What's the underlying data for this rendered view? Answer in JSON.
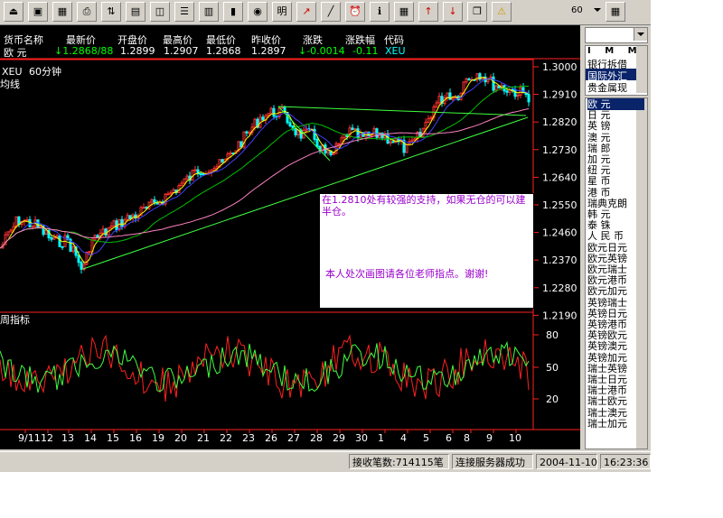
{
  "toolbar": {
    "buttons": [
      "exit-icon",
      "window-icon",
      "grid-icon",
      "print-icon",
      "sort-icon",
      "tile-icon",
      "chart-icon",
      "list-icon",
      "layout-icon",
      "bar-chart-icon",
      "ticker-icon",
      "month-chart",
      "trend-icon",
      "draw-line-icon",
      "alarm-icon",
      "info-icon",
      "calc-icon",
      "arrow-up-icon",
      "arrow-down-icon",
      "window-restore-icon",
      "warning-icon"
    ],
    "month_label": "明",
    "zoom_value": "60"
  },
  "quote_header": {
    "labels": [
      "货币名称",
      "最新价",
      "开盘价",
      "最高价",
      "最低价",
      "昨收价",
      "涨跌",
      "涨跌幅",
      "代码"
    ],
    "values": [
      "欧   元",
      "↓1.2868/88",
      "1.2899",
      "1.2907",
      "1.2868",
      "1.2897",
      "↓-0.0014",
      "-0.11",
      "XEU"
    ],
    "colors": {
      "label": "#ffffff",
      "name": "#ffffff",
      "down": "#00ff00",
      "normal": "#ffffff",
      "code": "#00ffff"
    }
  },
  "chart": {
    "symbol": "XEU",
    "period": "60分钟",
    "indicator_label": "均线",
    "lower_indicator_label": "周指标",
    "price_ticks": [
      "1.3000",
      "1.2910",
      "1.2820",
      "1.2730",
      "1.2640",
      "1.2550",
      "1.2460",
      "1.2370",
      "1.2280",
      "1.2190"
    ],
    "osc_ticks": [
      "80",
      "50",
      "20"
    ],
    "date_ticks": [
      "9/11",
      "12",
      "13",
      "14",
      "15",
      "16",
      "19",
      "20",
      "21",
      "22",
      "23",
      "26",
      "27",
      "28",
      "29",
      "30",
      "1",
      "4",
      "5",
      "6",
      "8",
      "9",
      "10"
    ],
    "annotation": {
      "line1": "在1.2810处有较强的支持，如果无仓的可以建半仓。",
      "line2": "本人处次画图请各位老师指点。谢谢!"
    }
  },
  "sidebar": {
    "tabs": [
      "银行拆借",
      "国际外汇",
      "贵金属现"
    ],
    "tab_header": "I M M",
    "currencies": [
      "欧    元",
      "日    元",
      "英    镑",
      "澳    元",
      "瑞    郎",
      "加    元",
      "纽    元",
      "星    币",
      "港    币",
      "瑞典克朗",
      "韩    元",
      "泰    铢",
      "人 民 币",
      "欧元日元",
      "欧元英镑",
      "欧元瑞士",
      "欧元港币",
      "欧元加元",
      "英镑瑞士",
      "英镑日元",
      "英镑港币",
      "英镑欧元",
      "英镑澳元",
      "英镑加元",
      "瑞士英镑",
      "瑞士日元",
      "瑞士港币",
      "瑞士欧元",
      "瑞士澳元",
      "瑞士加元"
    ],
    "selected_index": 0
  },
  "status": {
    "received": "接收笔数:714115笔",
    "connection": "连接服务器成功",
    "date": "2004-11-10",
    "time": "16:23:36"
  }
}
